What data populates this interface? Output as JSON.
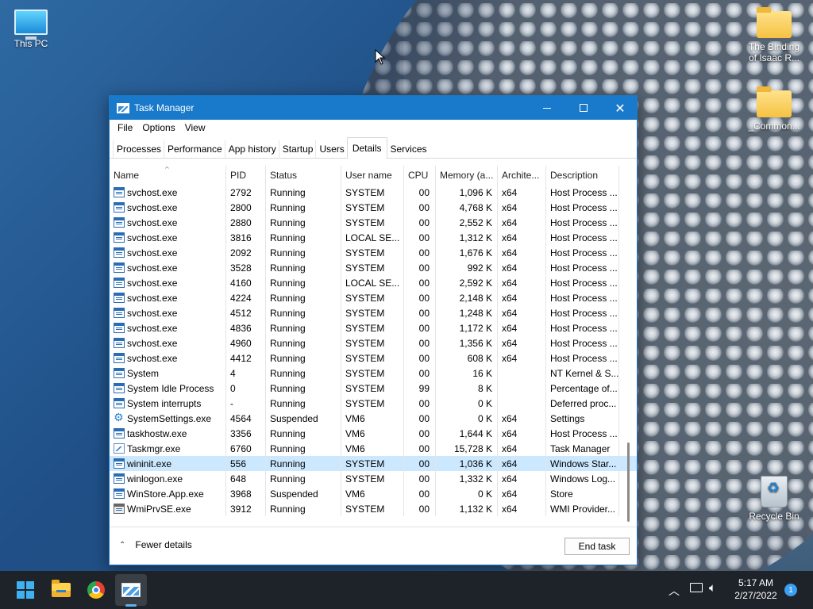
{
  "desktop": {
    "icons": [
      {
        "label": "This PC"
      },
      {
        "label": "The Binding of Isaac R..."
      },
      {
        "label": "_Common..."
      },
      {
        "label": "Recycle Bin"
      }
    ]
  },
  "window": {
    "title": "Task Manager",
    "controls": {
      "minimize": "minimize-icon",
      "maximize": "maximize-icon",
      "close": "close-icon"
    }
  },
  "menu": [
    "File",
    "Options",
    "View"
  ],
  "tabs": [
    "Processes",
    "Performance",
    "App history",
    "Startup",
    "Users",
    "Details",
    "Services"
  ],
  "active_tab": "Details",
  "columns": [
    "Name",
    "PID",
    "Status",
    "User name",
    "CPU",
    "Memory (a...",
    "Archite...",
    "Description"
  ],
  "rows": [
    {
      "name": "svchost.exe",
      "pid": "2792",
      "status": "Running",
      "user": "SYSTEM",
      "cpu": "00",
      "mem": "1,096 K",
      "arch": "x64",
      "desc": "Host Process ...",
      "icon": "service-icon"
    },
    {
      "name": "svchost.exe",
      "pid": "2800",
      "status": "Running",
      "user": "SYSTEM",
      "cpu": "00",
      "mem": "4,768 K",
      "arch": "x64",
      "desc": "Host Process ...",
      "icon": "service-icon"
    },
    {
      "name": "svchost.exe",
      "pid": "2880",
      "status": "Running",
      "user": "SYSTEM",
      "cpu": "00",
      "mem": "2,552 K",
      "arch": "x64",
      "desc": "Host Process ...",
      "icon": "service-icon"
    },
    {
      "name": "svchost.exe",
      "pid": "3816",
      "status": "Running",
      "user": "LOCAL SE...",
      "cpu": "00",
      "mem": "1,312 K",
      "arch": "x64",
      "desc": "Host Process ...",
      "icon": "service-icon"
    },
    {
      "name": "svchost.exe",
      "pid": "2092",
      "status": "Running",
      "user": "SYSTEM",
      "cpu": "00",
      "mem": "1,676 K",
      "arch": "x64",
      "desc": "Host Process ...",
      "icon": "service-icon"
    },
    {
      "name": "svchost.exe",
      "pid": "3528",
      "status": "Running",
      "user": "SYSTEM",
      "cpu": "00",
      "mem": "992 K",
      "arch": "x64",
      "desc": "Host Process ...",
      "icon": "service-icon"
    },
    {
      "name": "svchost.exe",
      "pid": "4160",
      "status": "Running",
      "user": "LOCAL SE...",
      "cpu": "00",
      "mem": "2,592 K",
      "arch": "x64",
      "desc": "Host Process ...",
      "icon": "service-icon"
    },
    {
      "name": "svchost.exe",
      "pid": "4224",
      "status": "Running",
      "user": "SYSTEM",
      "cpu": "00",
      "mem": "2,148 K",
      "arch": "x64",
      "desc": "Host Process ...",
      "icon": "service-icon"
    },
    {
      "name": "svchost.exe",
      "pid": "4512",
      "status": "Running",
      "user": "SYSTEM",
      "cpu": "00",
      "mem": "1,248 K",
      "arch": "x64",
      "desc": "Host Process ...",
      "icon": "service-icon"
    },
    {
      "name": "svchost.exe",
      "pid": "4836",
      "status": "Running",
      "user": "SYSTEM",
      "cpu": "00",
      "mem": "1,172 K",
      "arch": "x64",
      "desc": "Host Process ...",
      "icon": "service-icon"
    },
    {
      "name": "svchost.exe",
      "pid": "4960",
      "status": "Running",
      "user": "SYSTEM",
      "cpu": "00",
      "mem": "1,356 K",
      "arch": "x64",
      "desc": "Host Process ...",
      "icon": "service-icon"
    },
    {
      "name": "svchost.exe",
      "pid": "4412",
      "status": "Running",
      "user": "SYSTEM",
      "cpu": "00",
      "mem": "608 K",
      "arch": "x64",
      "desc": "Host Process ...",
      "icon": "service-icon"
    },
    {
      "name": "System",
      "pid": "4",
      "status": "Running",
      "user": "SYSTEM",
      "cpu": "00",
      "mem": "16 K",
      "arch": "",
      "desc": "NT Kernel & S...",
      "icon": "process-icon"
    },
    {
      "name": "System Idle Process",
      "pid": "0",
      "status": "Running",
      "user": "SYSTEM",
      "cpu": "99",
      "mem": "8 K",
      "arch": "",
      "desc": "Percentage of...",
      "icon": "process-icon"
    },
    {
      "name": "System interrupts",
      "pid": "-",
      "status": "Running",
      "user": "SYSTEM",
      "cpu": "00",
      "mem": "0 K",
      "arch": "",
      "desc": "Deferred proc...",
      "icon": "process-icon"
    },
    {
      "name": "SystemSettings.exe",
      "pid": "4564",
      "status": "Suspended",
      "user": "VM6",
      "cpu": "00",
      "mem": "0 K",
      "arch": "x64",
      "desc": "Settings",
      "icon": "gear-icon"
    },
    {
      "name": "taskhostw.exe",
      "pid": "3356",
      "status": "Running",
      "user": "VM6",
      "cpu": "00",
      "mem": "1,644 K",
      "arch": "x64",
      "desc": "Host Process ...",
      "icon": "process-icon"
    },
    {
      "name": "Taskmgr.exe",
      "pid": "6760",
      "status": "Running",
      "user": "VM6",
      "cpu": "00",
      "mem": "15,728 K",
      "arch": "x64",
      "desc": "Task Manager",
      "icon": "task-manager-icon"
    },
    {
      "name": "wininit.exe",
      "pid": "556",
      "status": "Running",
      "user": "SYSTEM",
      "cpu": "00",
      "mem": "1,036 K",
      "arch": "x64",
      "desc": "Windows Star...",
      "icon": "process-icon",
      "selected": true
    },
    {
      "name": "winlogon.exe",
      "pid": "648",
      "status": "Running",
      "user": "SYSTEM",
      "cpu": "00",
      "mem": "1,332 K",
      "arch": "x64",
      "desc": "Windows Log...",
      "icon": "process-icon"
    },
    {
      "name": "WinStore.App.exe",
      "pid": "3968",
      "status": "Suspended",
      "user": "VM6",
      "cpu": "00",
      "mem": "0 K",
      "arch": "x64",
      "desc": "Store",
      "icon": "process-icon"
    },
    {
      "name": "WmiPrvSE.exe",
      "pid": "3912",
      "status": "Running",
      "user": "SYSTEM",
      "cpu": "00",
      "mem": "1,132 K",
      "arch": "x64",
      "desc": "WMI Provider...",
      "icon": "wmi-icon"
    }
  ],
  "footer": {
    "fewer_details": "Fewer details",
    "end_task": "End task"
  },
  "taskbar": {
    "apps": [
      "start-icon",
      "file-explorer-icon",
      "chrome-icon",
      "task-manager-icon"
    ],
    "time": "5:17 AM",
    "date": "2/27/2022",
    "notification_count": "1"
  },
  "colors": {
    "accent": "#1979ca",
    "selected_row": "#cce8ff"
  }
}
